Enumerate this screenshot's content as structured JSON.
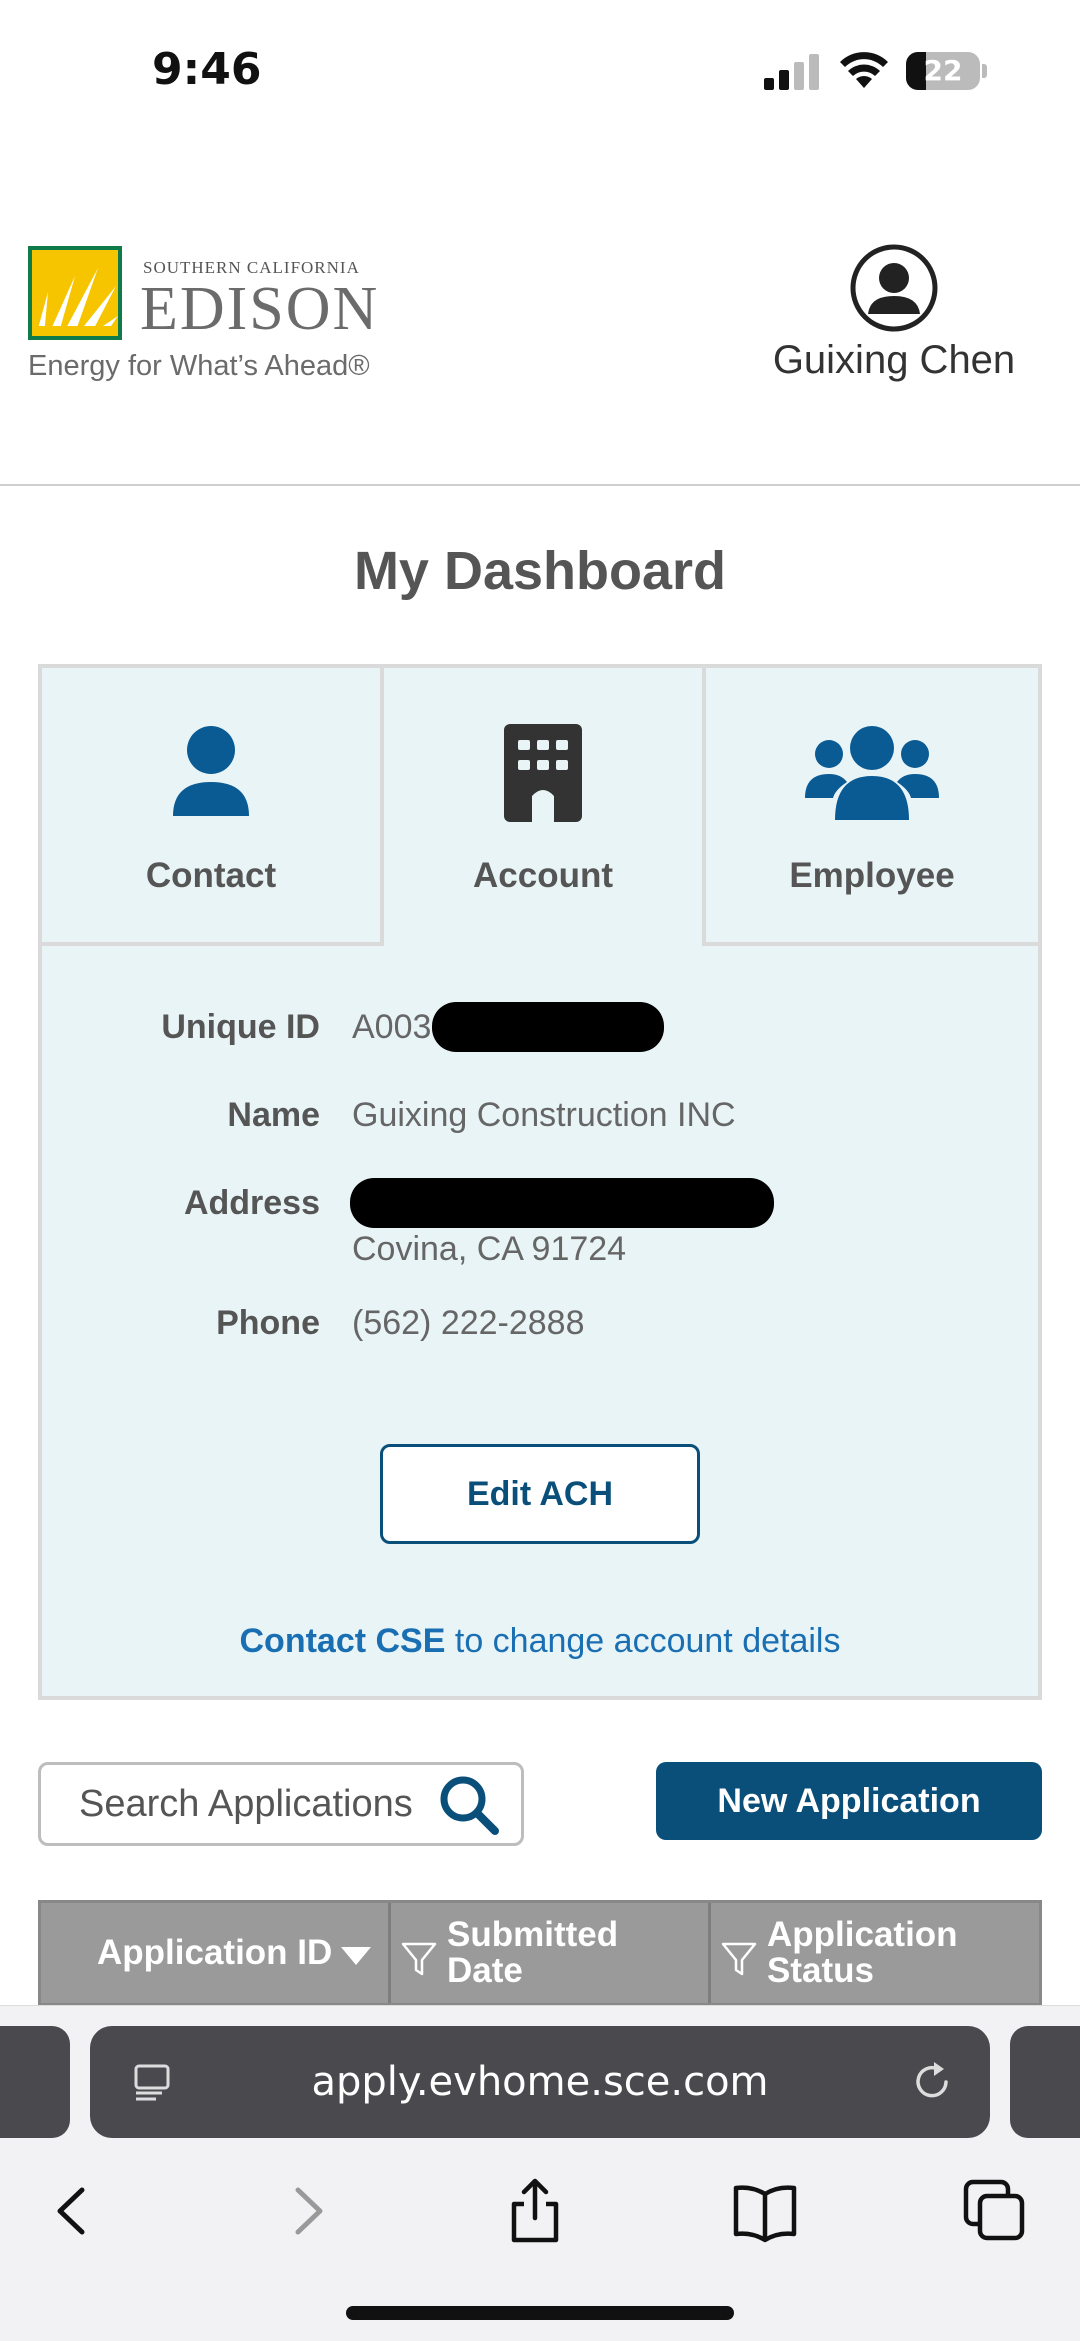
{
  "status_bar": {
    "time": "9:46",
    "battery": "22"
  },
  "header": {
    "logo": {
      "small_text": "SOUTHERN CALIFORNIA",
      "big_text": "EDISON",
      "tagline": "Energy for What’s Ahead®"
    },
    "user_name": "Guixing Chen"
  },
  "dashboard": {
    "title": "My Dashboard",
    "tabs": [
      {
        "label": "Contact",
        "icon": "person-icon"
      },
      {
        "label": "Account",
        "icon": "building-icon"
      },
      {
        "label": "Employee",
        "icon": "group-icon"
      }
    ],
    "account": {
      "unique_id_label": "Unique ID",
      "unique_id_value": "A003",
      "name_label": "Name",
      "name_value": "Guixing Construction INC",
      "address_label": "Address",
      "address_line2": "Covina, CA 91724",
      "phone_label": "Phone",
      "phone_value": "(562) 222-2888"
    },
    "edit_ach_label": "Edit ACH",
    "contact_link": "Contact CSE",
    "contact_rest": " to change account details"
  },
  "search": {
    "placeholder": "Search Applications"
  },
  "new_application_label": "New Application",
  "table": {
    "headers": [
      {
        "line1": "Application ID",
        "line2": ""
      },
      {
        "line1": "Submitted",
        "line2": "Date"
      },
      {
        "line1": "Application",
        "line2": "Status"
      }
    ]
  },
  "browser": {
    "url": "apply.evhome.sce.com"
  },
  "colors": {
    "brand_blue": "#0a4f7a",
    "link_blue": "#1a6fb3",
    "panel_bg": "#e8f4f6"
  }
}
